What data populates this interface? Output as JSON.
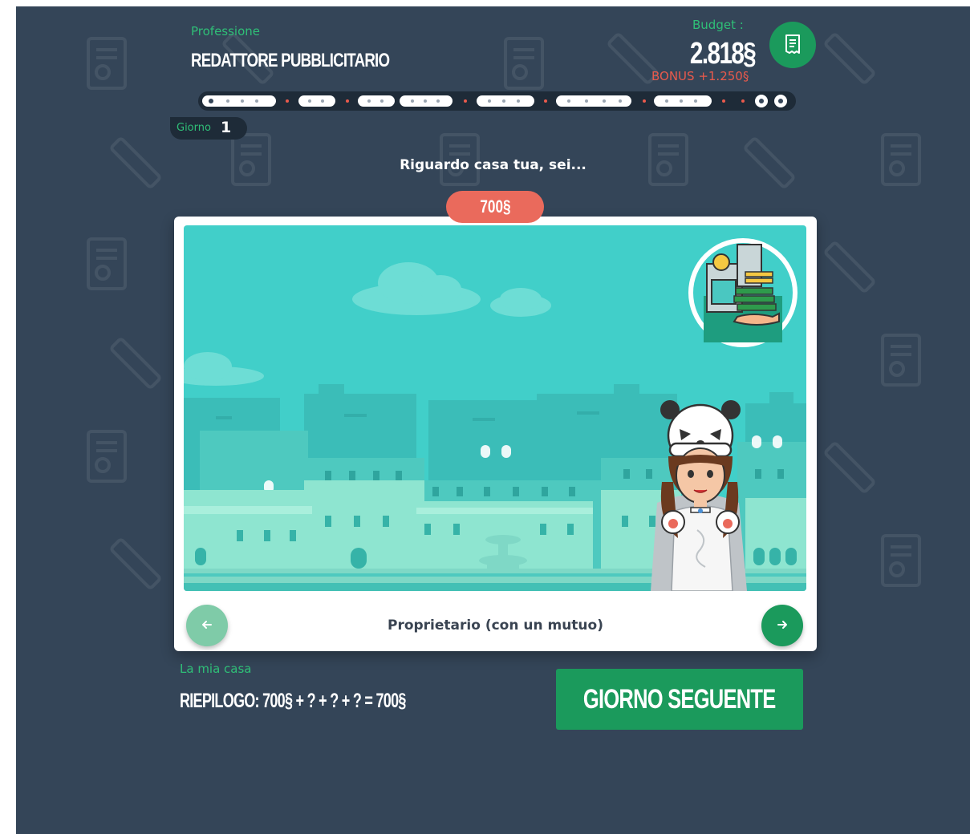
{
  "header": {
    "profession_label": "Professione",
    "profession_name": "REDATTORE PUBBLICITARIO",
    "budget_label": "Budget :",
    "budget_value": "2.818§",
    "bonus": "BONUS +1.250§"
  },
  "progress": {
    "current_day_label": "Giorno",
    "current_day": "1"
  },
  "question": {
    "text": "Riguardo casa tua, sei...",
    "price": "700§",
    "option_label": "Proprietario (con un mutuo)"
  },
  "footer": {
    "home_label": "La mia casa",
    "summary": "RIEPILOGO: 700§ + ? + ? + ? = 700§",
    "next_button": "GIORNO SEGUENTE"
  },
  "icons": {
    "budget_button": "receipt-icon",
    "prev": "arrow-left-icon",
    "next": "arrow-right-icon",
    "option_badge": "bank-money-icon"
  },
  "colors": {
    "background": "#344558",
    "accent_green": "#1b9a5c",
    "label_green": "#2fbf77",
    "bonus_red": "#ea5a4c",
    "price_pill": "#ea6a5c",
    "scene_sky": "#41cfc9"
  }
}
